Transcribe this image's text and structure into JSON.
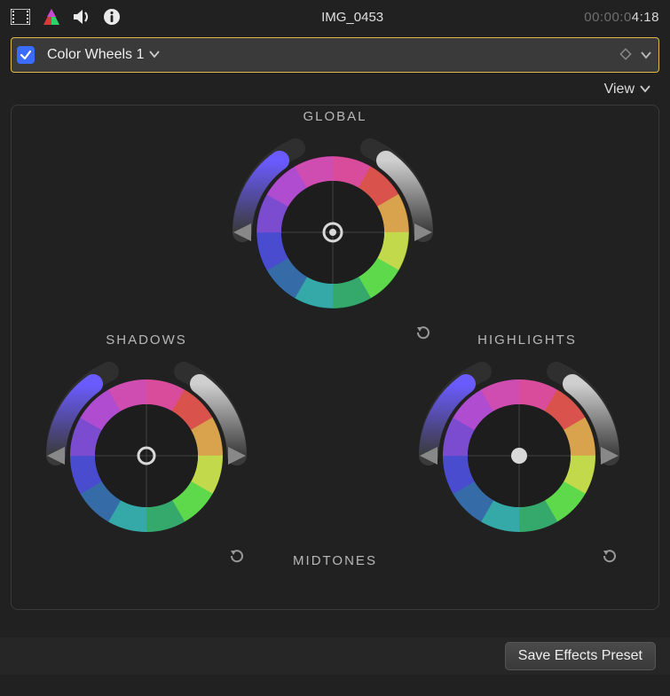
{
  "topbar": {
    "clip_title": "IMG_0453",
    "timecode_dim": "00:00:0",
    "timecode_bright": "4:18"
  },
  "correction_bar": {
    "enabled": true,
    "name": "Color Wheels 1"
  },
  "view_menu": {
    "label": "View"
  },
  "wheels": {
    "global": {
      "label": "GLOBAL"
    },
    "shadows": {
      "label": "SHADOWS"
    },
    "highlights": {
      "label": "HIGHLIGHTS"
    },
    "midtones": {
      "label": "MIDTONES"
    }
  },
  "footer": {
    "save_preset": "Save Effects Preset"
  },
  "colors": {
    "accent_blue": "#3a6dff",
    "focus_yellow": "#e0b94a"
  }
}
